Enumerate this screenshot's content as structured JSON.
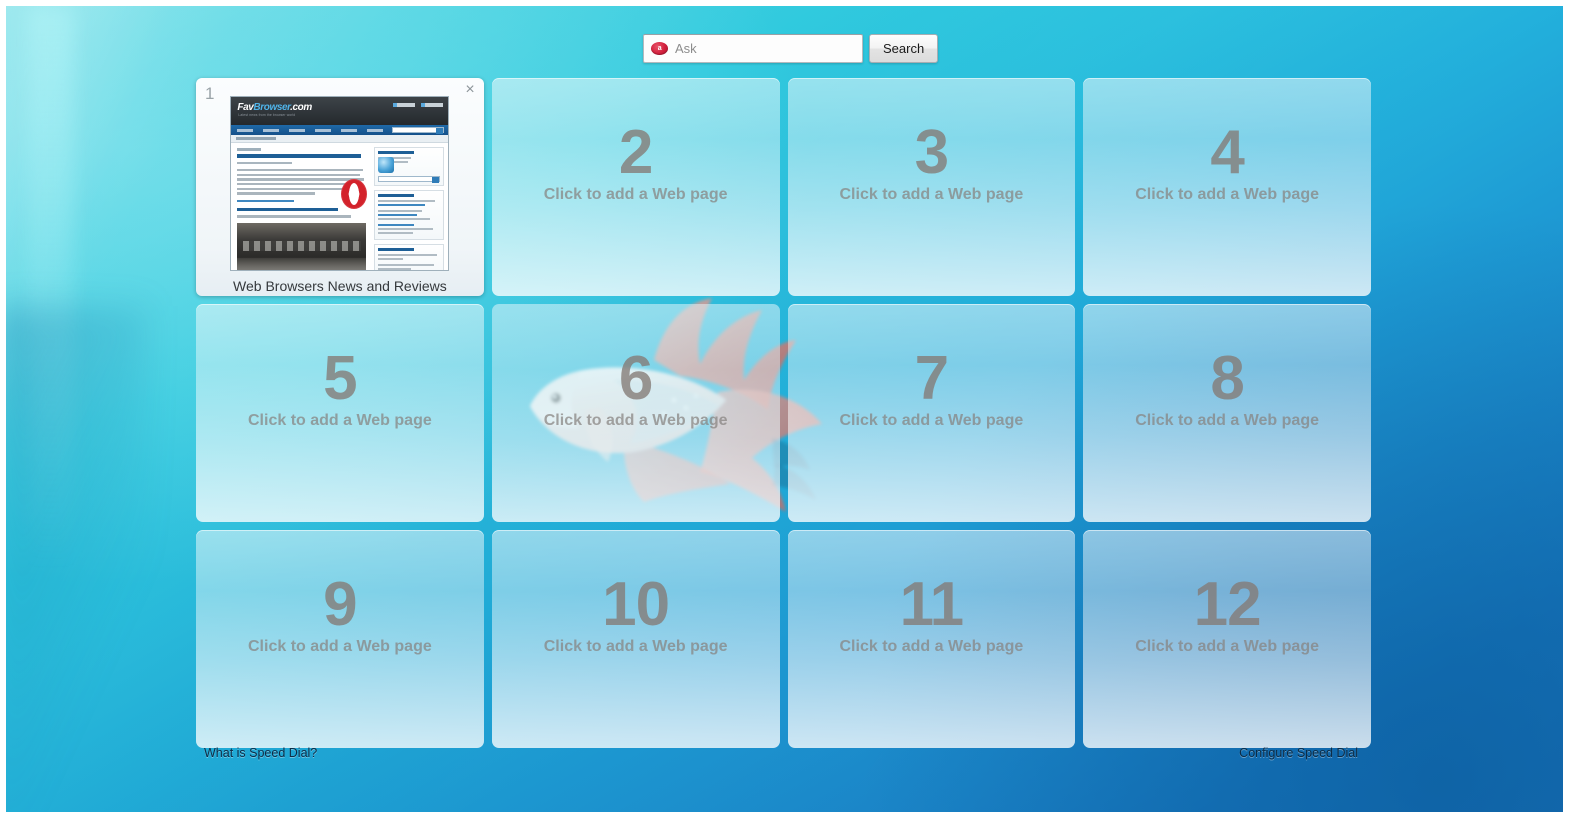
{
  "search": {
    "logo_icon": "ask-logo-icon",
    "logo_text": "a",
    "placeholder": "Ask",
    "value": "",
    "button_label": "Search"
  },
  "speed_dial": {
    "tiles": [
      {
        "index": "1",
        "state": "filled",
        "title": "Web Browsers News and Reviews",
        "close_label": "×",
        "thumbnail": {
          "site_logo_fav": "Fav",
          "site_logo_browser": "Browser",
          "site_logo_com": ".com",
          "site_tagline": "Latest news from the browser world"
        }
      },
      {
        "index": "2",
        "state": "empty",
        "caption": "Click to add a Web page"
      },
      {
        "index": "3",
        "state": "empty",
        "caption": "Click to add a Web page"
      },
      {
        "index": "4",
        "state": "empty",
        "caption": "Click to add a Web page"
      },
      {
        "index": "5",
        "state": "empty",
        "caption": "Click to add a Web page"
      },
      {
        "index": "6",
        "state": "empty",
        "caption": "Click to add a Web page"
      },
      {
        "index": "7",
        "state": "empty",
        "caption": "Click to add a Web page"
      },
      {
        "index": "8",
        "state": "empty",
        "caption": "Click to add a Web page"
      },
      {
        "index": "9",
        "state": "empty",
        "caption": "Click to add a Web page"
      },
      {
        "index": "10",
        "state": "empty",
        "caption": "Click to add a Web page"
      },
      {
        "index": "11",
        "state": "empty",
        "caption": "Click to add a Web page"
      },
      {
        "index": "12",
        "state": "empty",
        "caption": "Click to add a Web page"
      }
    ]
  },
  "footer": {
    "what_is_speed_dial": "What is Speed Dial?",
    "configure_speed_dial": "Configure Speed Dial"
  },
  "colors": {
    "background_top": "#86efef",
    "background_bottom": "#1a72ba",
    "tile_number": "#847a75",
    "tile_caption": "#878280",
    "ask_logo_red": "#d21f3c",
    "link_text": "#0d2c46"
  },
  "wallpaper": {
    "subject": "betta-fish",
    "body_color": "#f4e9e6",
    "fin_color": "#e9776b"
  }
}
